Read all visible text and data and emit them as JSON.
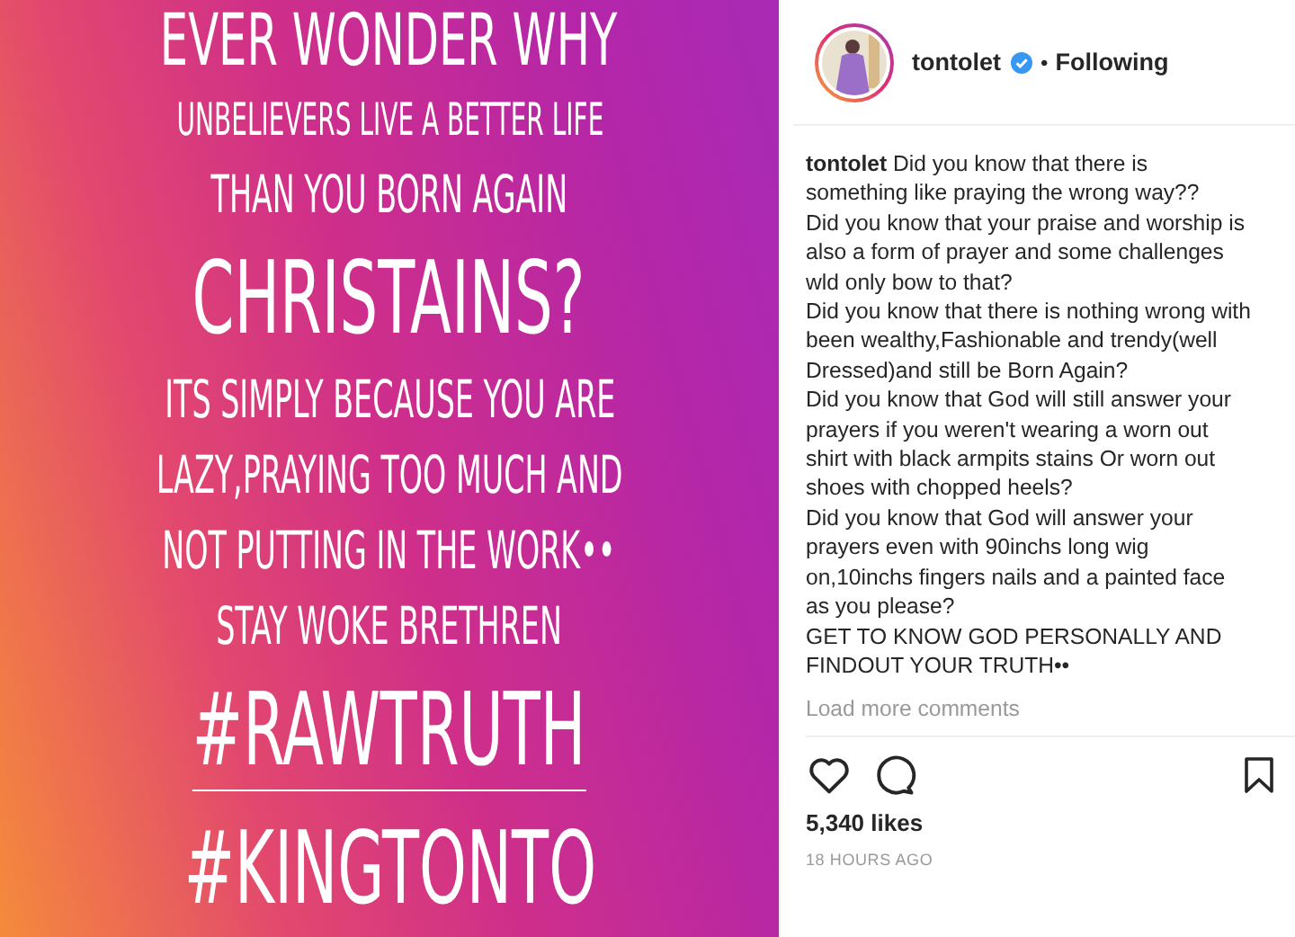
{
  "post_image": {
    "lines": [
      {
        "text": "EVER WONDER WHY",
        "kind": "large"
      },
      {
        "text": "UNBELIEVERS LIVE A BETTER LIFE",
        "kind": "small"
      },
      {
        "text": "THAN YOU BORN AGAIN",
        "kind": "medium"
      },
      {
        "text": "CHRISTAINS?",
        "kind": "huge"
      },
      {
        "text": "ITS SIMPLY BECAUSE YOU ARE",
        "kind": "medium"
      },
      {
        "text": "LAZY,PRAYING TOO MUCH AND",
        "kind": "medium"
      },
      {
        "text": "NOT PUTTING IN THE WORK••",
        "kind": "medium"
      },
      {
        "text": "STAY WOKE BRETHREN",
        "kind": "medium"
      },
      {
        "text": "#RAWTRUTH",
        "kind": "huge",
        "underlined": true
      },
      {
        "text": "#KINGTONTO",
        "kind": "huge",
        "underlined": false
      }
    ]
  },
  "header": {
    "username": "tontolet",
    "verified": true,
    "separator": "•",
    "follow_label": "Following"
  },
  "caption": {
    "username": "tontolet",
    "paragraphs": [
      "Did you know that there is something like praying the wrong way??",
      "Did you know that your praise and worship is also a form of prayer and some challenges wld only bow to that?",
      "Did you know that there is nothing wrong with been wealthy,Fashionable and trendy(well Dressed)and still be Born Again?",
      "Did you know that God will still answer your prayers if you weren't wearing a worn out shirt with black armpits stains Or worn out shoes with chopped heels?",
      "Did you know that God will answer your prayers even with 90inchs long wig on,10inchs fingers nails and a painted face as you please?",
      "GET TO KNOW GOD PERSONALLY AND FINDOUT YOUR TRUTH••"
    ]
  },
  "load_more": "Load more comments",
  "actions": {
    "liked": false,
    "saved": false
  },
  "likes": "5,340 likes",
  "time": "18 HOURS AGO"
}
